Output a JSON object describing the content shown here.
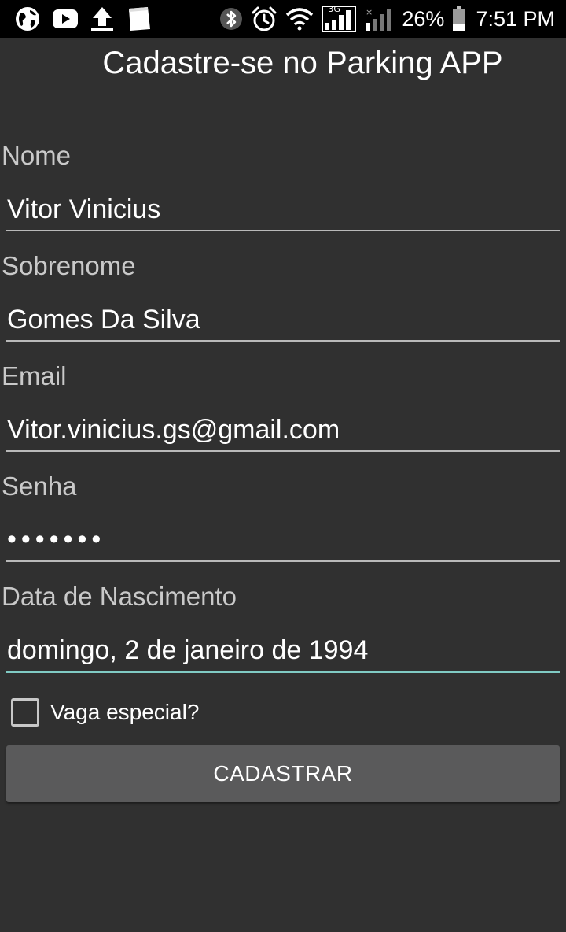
{
  "status_bar": {
    "left_icons": [
      "globe-icon",
      "youtube-icon",
      "upload-icon",
      "notes-icon"
    ],
    "right_icons": [
      "bluetooth-icon",
      "alarm-icon",
      "wifi-icon",
      "signal-3g-icon",
      "signal-2-icon",
      "battery-icon"
    ],
    "network_label": "3G",
    "battery": "26%",
    "time": "7:51 PM"
  },
  "app": {
    "title": "Cadastre-se no Parking APP"
  },
  "form": {
    "nome": {
      "label": "Nome",
      "value": "Vitor Vinicius"
    },
    "sobrenome": {
      "label": "Sobrenome",
      "value": "Gomes Da Silva"
    },
    "email": {
      "label": "Email",
      "value": "Vitor.vinicius.gs@gmail.com"
    },
    "senha": {
      "label": "Senha",
      "value": "•••••••"
    },
    "data_nascimento": {
      "label": "Data de Nascimento",
      "value": "domingo, 2 de janeiro de 1994"
    },
    "vaga_especial": {
      "label": "Vaga especial?",
      "checked": false
    },
    "submit_label": "CADASTRAR"
  },
  "colors": {
    "background": "#303030",
    "status_bar": "#000000",
    "accent_underline": "#80cbc4",
    "button": "#5a5a5b"
  }
}
